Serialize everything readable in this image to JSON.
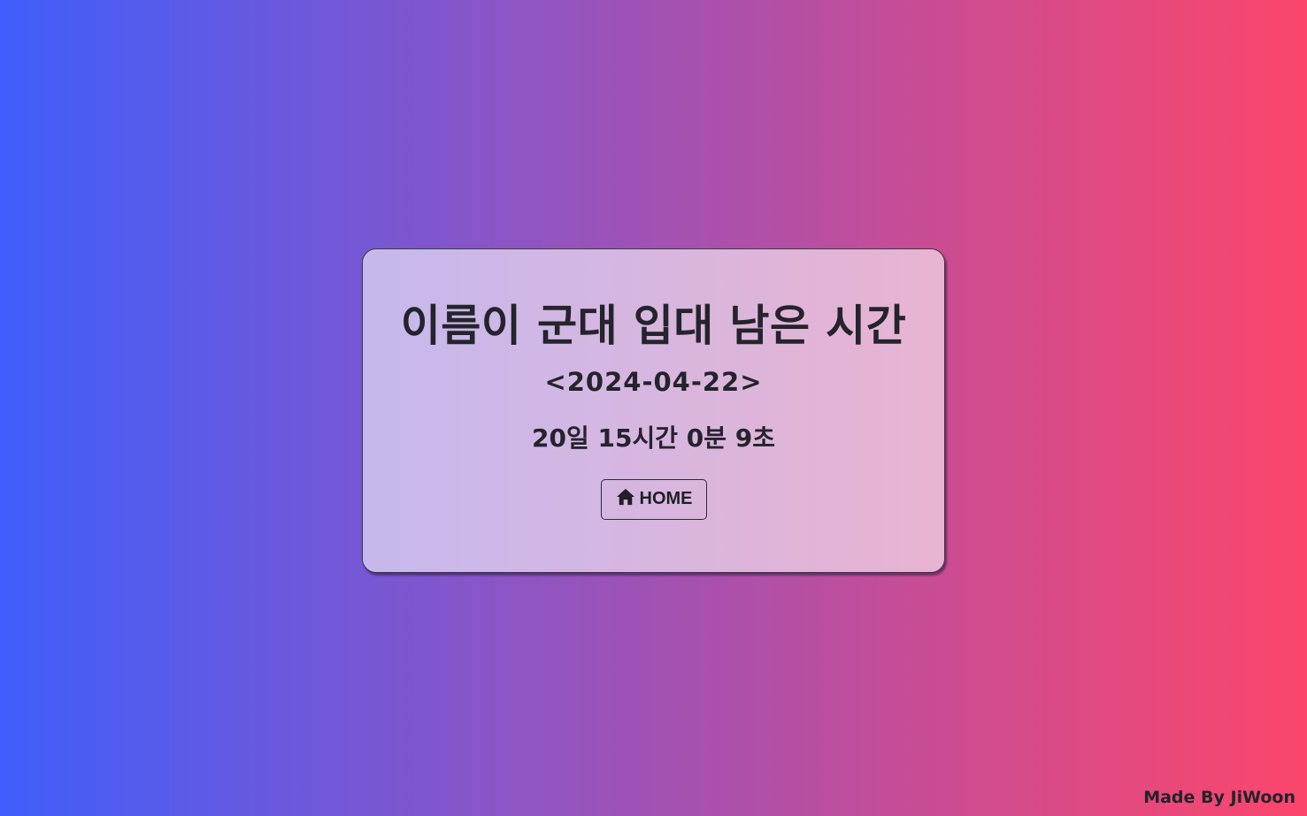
{
  "card": {
    "title": "이름이 군대 입대 남은 시간",
    "date": "<2024-04-22>",
    "countdown": "20일 15시간 0분 9초",
    "home_button": {
      "label": "HOME",
      "icon": "home-icon"
    }
  },
  "footer": {
    "credit": "Made By JiWoon"
  },
  "colors": {
    "gradient_start": "#3f5efb",
    "gradient_end": "#fc466b",
    "card_background": "rgba(255,255,255,0.58)",
    "text": "#24242c"
  }
}
